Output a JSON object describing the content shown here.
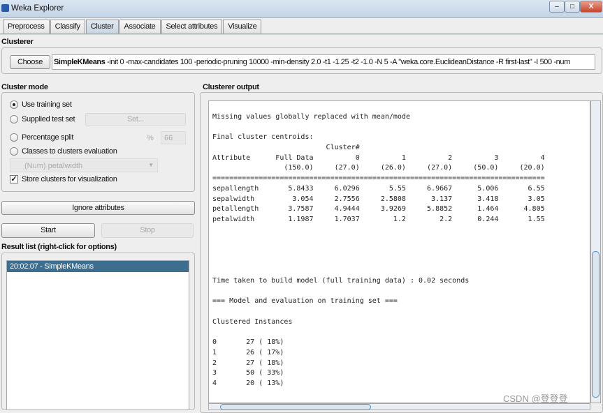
{
  "window": {
    "title": "Weka Explorer",
    "minimize": "–",
    "maximize": "□",
    "close": "X"
  },
  "tabs": [
    "Preprocess",
    "Classify",
    "Cluster",
    "Associate",
    "Select attributes",
    "Visualize"
  ],
  "active_tab": "Cluster",
  "clusterer": {
    "label": "Clusterer",
    "choose": "Choose",
    "name": "SimpleKMeans",
    "options": " -init 0 -max-candidates 100 -periodic-pruning 10000 -min-density 2.0 -t1 -1.25 -t2 -1.0 -N 5 -A \"weka.core.EuclideanDistance -R first-last\" -I 500 -num"
  },
  "cluster_mode": {
    "label": "Cluster mode",
    "use_training": "Use training set",
    "supplied_test": "Supplied test set",
    "set_button": "Set...",
    "percentage_split": "Percentage split",
    "percent_sign": "%",
    "percent_value": "66",
    "classes_to_clusters": "Classes to clusters evaluation",
    "class_attribute": "(Num) petalwidth",
    "store_clusters": "Store clusters for visualization",
    "selected": "Use training set",
    "store_checked": true
  },
  "ignore_attributes": "Ignore attributes",
  "start": "Start",
  "stop": "Stop",
  "result_list": {
    "label": "Result list (right-click for options)",
    "items": [
      "20:02:07 - SimpleKMeans"
    ]
  },
  "output": {
    "label": "Clusterer output",
    "lines": [
      "Missing values globally replaced with mean/mode",
      "",
      "Final cluster centroids:",
      "                           Cluster#",
      "Attribute      Full Data          0          1          2          3          4",
      "                 (150.0)     (27.0)     (26.0)     (27.0)     (50.0)     (20.0)",
      "===============================================================================",
      "sepallength       5.8433     6.0296       5.55     6.9667      5.006       6.55",
      "sepalwidth         3.054     2.7556     2.5808      3.137      3.418       3.05",
      "petallength       3.7587     4.9444     3.9269     5.8852      1.464      4.805",
      "petalwidth        1.1987     1.7037        1.2        2.2      0.244       1.55",
      "",
      "",
      "",
      "",
      "",
      "Time taken to build model (full training data) : 0.02 seconds",
      "",
      "=== Model and evaluation on training set ===",
      "",
      "Clustered Instances",
      "",
      "0       27 ( 18%)",
      "1       26 ( 17%)",
      "2       27 ( 18%)",
      "3       50 ( 33%)",
      "4       20 ( 13%)"
    ]
  },
  "watermark": "CSDN @登登登",
  "colors": {
    "selection": "#3d6d8f",
    "titlebar": "#c4d4e6"
  }
}
